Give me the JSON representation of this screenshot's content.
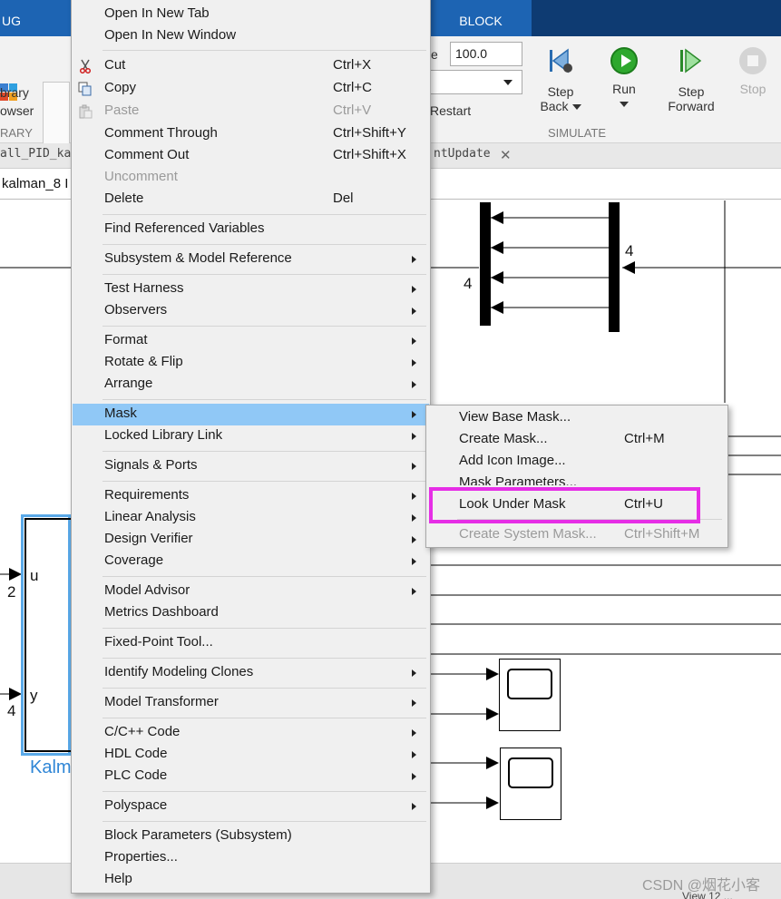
{
  "ribbon": {
    "tab_left": "UG",
    "tab_block": "BLOCK",
    "library_browser_line1": "brary",
    "library_browser_line2": "owser",
    "library_section": "RARY",
    "stop_time": "100.0",
    "restart_label": "Restart",
    "step_back_line1": "Step",
    "step_back_line2": "Back",
    "run_label": "Run",
    "step_forward_line1": "Step",
    "step_forward_line2": "Forward",
    "stop_label": "Stop",
    "simulate_section": "SIMULATE"
  },
  "doc_tabs": {
    "left_tab": "all_PID_ka",
    "right_tab": "ntUpdate",
    "close_glyph": "✕"
  },
  "breadcrumb": "kalman_8 I",
  "canvas": {
    "mux_port_label": "4",
    "demux_port_label": "4",
    "port_u": "u",
    "port_y": "y",
    "in_port_2": "2",
    "in_port_4": "4",
    "block_name": "Kalm"
  },
  "context_menu": {
    "items": [
      {
        "label": "Open In New Tab"
      },
      {
        "label": "Open In New Window"
      },
      {
        "label": "Cut",
        "shortcut": "Ctrl+X",
        "icon": "scissors-icon"
      },
      {
        "label": "Copy",
        "shortcut": "Ctrl+C",
        "icon": "copy-icon"
      },
      {
        "label": "Paste",
        "shortcut": "Ctrl+V",
        "icon": "paste-icon",
        "disabled": true
      },
      {
        "label": "Comment Through",
        "shortcut": "Ctrl+Shift+Y"
      },
      {
        "label": "Comment Out",
        "shortcut": "Ctrl+Shift+X"
      },
      {
        "label": "Uncomment",
        "disabled": true
      },
      {
        "label": "Delete",
        "shortcut": "Del"
      },
      {
        "label": "Find Referenced Variables"
      },
      {
        "label": "Subsystem & Model Reference",
        "submenu": true
      },
      {
        "label": "Test Harness",
        "submenu": true
      },
      {
        "label": "Observers",
        "submenu": true
      },
      {
        "label": "Format",
        "submenu": true
      },
      {
        "label": "Rotate & Flip",
        "submenu": true
      },
      {
        "label": "Arrange",
        "submenu": true
      },
      {
        "label": "Mask",
        "submenu": true,
        "highlighted": true
      },
      {
        "label": "Locked Library Link",
        "submenu": true
      },
      {
        "label": "Signals & Ports",
        "submenu": true
      },
      {
        "label": "Requirements",
        "submenu": true
      },
      {
        "label": "Linear Analysis",
        "submenu": true
      },
      {
        "label": "Design Verifier",
        "submenu": true
      },
      {
        "label": "Coverage",
        "submenu": true
      },
      {
        "label": "Model Advisor",
        "submenu": true
      },
      {
        "label": "Metrics Dashboard"
      },
      {
        "label": "Fixed-Point Tool..."
      },
      {
        "label": "Identify Modeling Clones",
        "submenu": true
      },
      {
        "label": "Model Transformer",
        "submenu": true
      },
      {
        "label": "C/C++ Code",
        "submenu": true
      },
      {
        "label": "HDL Code",
        "submenu": true
      },
      {
        "label": "PLC Code",
        "submenu": true
      },
      {
        "label": "Polyspace",
        "submenu": true
      },
      {
        "label": "Block Parameters (Subsystem)"
      },
      {
        "label": "Properties..."
      },
      {
        "label": "Help"
      }
    ]
  },
  "mask_submenu": {
    "items": [
      {
        "label": "View Base Mask..."
      },
      {
        "label": "Create Mask...",
        "shortcut": "Ctrl+M"
      },
      {
        "label": "Add Icon Image..."
      },
      {
        "label": "Mask Parameters..."
      },
      {
        "label": "Look Under Mask",
        "shortcut": "Ctrl+U"
      },
      {
        "label": "Create System Mask...",
        "shortcut": "Ctrl+Shift+M",
        "disabled": true
      }
    ]
  },
  "colors": {
    "menu_highlight": "#90c8f6",
    "annotation_box": "#e62ee6",
    "ribbon_tab": "#1d64b3",
    "selected_block": "#5aa9e8"
  },
  "watermark": "CSDN @烟花小客",
  "status_text": "View 12 ..."
}
